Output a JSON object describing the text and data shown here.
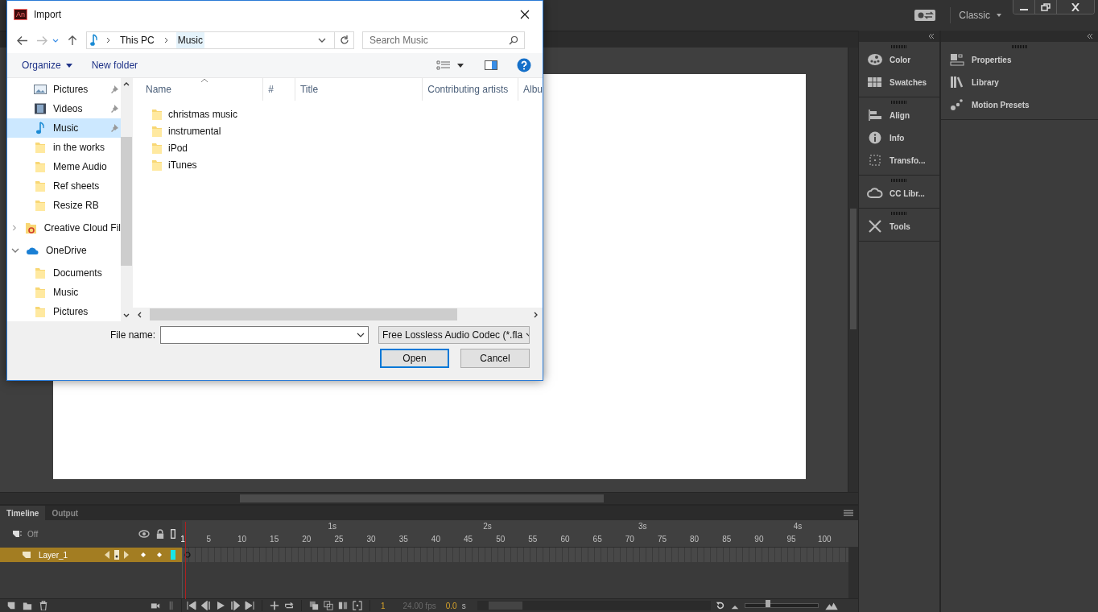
{
  "app": {
    "workspace": "Classic"
  },
  "panels": [
    {
      "items": [
        {
          "label": "Color",
          "kind": "color"
        },
        {
          "label": "Swatches",
          "kind": "swatches"
        }
      ]
    },
    {
      "items": [
        {
          "label": "Align",
          "kind": "align"
        },
        {
          "label": "Info",
          "kind": "info"
        },
        {
          "label": "Transfo...",
          "kind": "transform"
        }
      ]
    },
    {
      "items": [
        {
          "label": "CC Libr...",
          "kind": "cc"
        }
      ]
    },
    {
      "items": [
        {
          "label": "Tools",
          "kind": "tools"
        }
      ]
    }
  ],
  "panels_wide": [
    {
      "label": "Properties",
      "kind": "properties"
    },
    {
      "label": "Library",
      "kind": "library"
    },
    {
      "label": "Motion Presets",
      "kind": "motion"
    }
  ],
  "timeline": {
    "tabs": [
      {
        "label": "Timeline",
        "selected": true
      },
      {
        "label": "Output",
        "selected": false
      }
    ],
    "outline_label": "Off",
    "layers": [
      {
        "name": "Layer_1",
        "selected": true
      }
    ],
    "seconds": [
      "1s",
      "2s",
      "3s",
      "4s"
    ],
    "frames": [
      "1",
      "5",
      "10",
      "15",
      "20",
      "25",
      "30",
      "35",
      "40",
      "45",
      "50",
      "55",
      "60",
      "65",
      "70",
      "75",
      "80",
      "85",
      "90",
      "95",
      "100"
    ],
    "zoom": {
      "level": 0.3
    },
    "current_frame": "1",
    "fps": "24.00 fps",
    "time": "0.0",
    "time_unit": "s"
  },
  "dialog": {
    "title": "Import",
    "app_badge": "An",
    "breadcrumb": [
      "This PC",
      "Music"
    ],
    "search": {
      "placeholder": "Search Music"
    },
    "toolbar": [
      "Organize",
      "New folder"
    ],
    "quick_access": [
      {
        "label": "Pictures",
        "kind": "pictures",
        "pinned": true,
        "selected": false
      },
      {
        "label": "Videos",
        "kind": "videos",
        "pinned": true,
        "selected": false
      },
      {
        "label": "Music",
        "kind": "music",
        "pinned": true,
        "selected": true
      },
      {
        "label": "in the works",
        "kind": "folder",
        "pinned": false,
        "selected": false
      },
      {
        "label": "Meme Audio",
        "kind": "folder",
        "pinned": false,
        "selected": false
      },
      {
        "label": "Ref sheets",
        "kind": "folder",
        "pinned": false,
        "selected": false
      },
      {
        "label": "Resize RB",
        "kind": "folder",
        "pinned": false,
        "selected": false
      }
    ],
    "roots": [
      {
        "label": "Creative Cloud Fil",
        "kind": "cc",
        "expanded": false
      },
      {
        "label": "OneDrive",
        "kind": "onedrive",
        "expanded": true,
        "children": [
          {
            "label": "Documents"
          },
          {
            "label": "Music"
          },
          {
            "label": "Pictures"
          }
        ]
      }
    ],
    "columns": [
      "Name",
      "#",
      "Title",
      "Contributing artists",
      "Albu"
    ],
    "files": [
      "christmas music",
      "instrumental",
      "iPod",
      "iTunes"
    ],
    "file_name_label": "File name:",
    "filter": "Free Lossless Audio Codec (*.fla",
    "buttons": [
      {
        "label": "Open",
        "default": true
      },
      {
        "label": "Cancel",
        "default": false
      }
    ]
  }
}
